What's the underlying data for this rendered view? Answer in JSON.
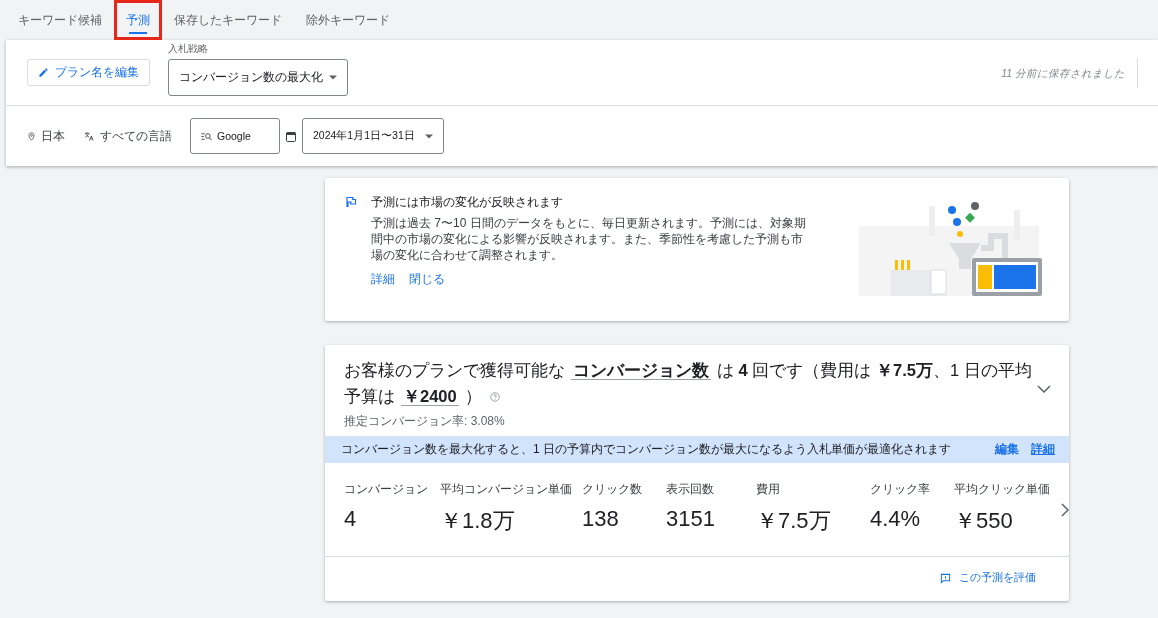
{
  "tabs": [
    {
      "label": "キーワード候補",
      "selected": false
    },
    {
      "label": "予測",
      "selected": true
    },
    {
      "label": "保存したキーワード",
      "selected": false
    },
    {
      "label": "除外キーワード",
      "selected": false
    }
  ],
  "toolbar": {
    "edit_plan_button": "プラン名を編集",
    "bid_strategy": {
      "label": "入札戦略",
      "value": "コンバージョン数の最大化"
    },
    "saved_status": "11 分前に保存されました"
  },
  "filters": {
    "location": "日本",
    "language": "すべての言語",
    "network": "Google",
    "date_range": "2024年1月1日〜31日"
  },
  "notice": {
    "title": "予測には市場の変化が反映されます",
    "body": "予測は過去 7〜10 日間のデータをもとに、毎日更新されます。予測には、対象期間中の市場の変化による影響が反映されます。また、季節性を考慮した予測も市場の変化に合わせて調整されます。",
    "links": [
      "詳細",
      "閉じる"
    ]
  },
  "forecast": {
    "headline": [
      {
        "kind": "text",
        "text": "お客様のプランで獲得可能な"
      },
      {
        "kind": "select",
        "text": "コンバージョン数"
      },
      {
        "kind": "text",
        "text": "は **4** 回です（費用は **￥7.5万**、1 日の平均予算は"
      },
      {
        "kind": "select",
        "text": "￥2400"
      },
      {
        "kind": "text",
        "text": "）"
      }
    ],
    "conversion_rate": "推定コンバージョン率: 3.08%",
    "banner": {
      "text": "コンバージョン数を最大化すると、1 日の予算内でコンバージョン数が最大になるよう入札単価が最適化されます",
      "links": [
        "編集",
        "詳細"
      ]
    },
    "metrics": [
      {
        "label": "コンバージョン",
        "value": "4"
      },
      {
        "label": "平均コンバージョン単価",
        "value": "￥1.8万"
      },
      {
        "label": "クリック数",
        "value": "138"
      },
      {
        "label": "表示回数",
        "value": "3151"
      },
      {
        "label": "費用",
        "value": "￥7.5万"
      },
      {
        "label": "クリック率",
        "value": "4.4%"
      },
      {
        "label": "平均クリック単価",
        "value": "￥550"
      }
    ],
    "rate_button": "この予測を評価"
  }
}
